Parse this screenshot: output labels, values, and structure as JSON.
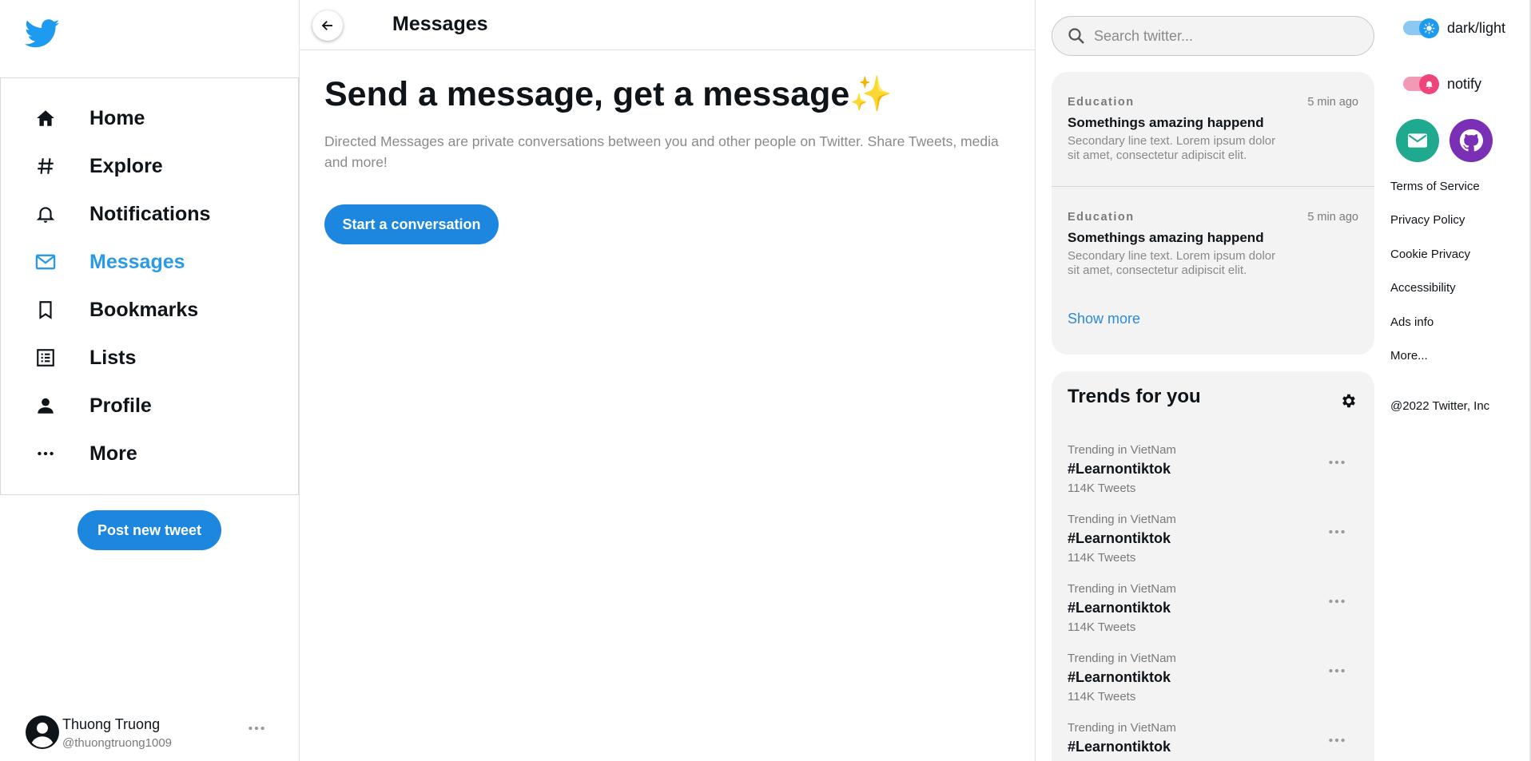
{
  "colors": {
    "accent": "#1d86df",
    "active_nav": "#2a9ae8",
    "twitter_blue": "#1d9bf0",
    "panel_bg": "#f3f3f3",
    "notify_pink": "#f0457a",
    "mail_teal": "#1faa8f",
    "github_purple": "#7b2fb4"
  },
  "sidebar": {
    "logo_icon": "twitter-bird-icon",
    "items": [
      {
        "label": "Home",
        "icon": "home-icon"
      },
      {
        "label": "Explore",
        "icon": "hashtag-icon"
      },
      {
        "label": "Notifications",
        "icon": "bell-icon"
      },
      {
        "label": "Messages",
        "icon": "mail-icon",
        "active": true
      },
      {
        "label": "Bookmarks",
        "icon": "bookmark-icon"
      },
      {
        "label": "Lists",
        "icon": "list-icon"
      },
      {
        "label": "Profile",
        "icon": "person-icon"
      },
      {
        "label": "More",
        "icon": "more-horizontal-icon"
      }
    ],
    "post_button": "Post new tweet",
    "user": {
      "name": "Thuong Truong",
      "handle": "@thuongtruong1009"
    }
  },
  "main": {
    "header_title": "Messages",
    "hero_title": "Send a message, get a message",
    "hero_emoji": "✨",
    "description": "Directed Messages are private conversations between you and other people on Twitter. Share Tweets, media and more!",
    "start_button": "Start a conversation"
  },
  "search": {
    "placeholder": "Search twitter..."
  },
  "news": {
    "items": [
      {
        "category": "Education",
        "time": "5 min ago",
        "title": "Somethings amazing happend",
        "body": "Secondary line text. Lorem ipsum dolor sit amet, consectetur adipiscit elit."
      },
      {
        "category": "Education",
        "time": "5 min ago",
        "title": "Somethings amazing happend",
        "body": "Secondary line text. Lorem ipsum dolor sit amet, consectetur adipiscit elit."
      }
    ],
    "show_more": "Show more"
  },
  "trends": {
    "title": "Trends for you",
    "items": [
      {
        "place": "Trending in VietNam",
        "tag": "#Learnontiktok",
        "count": "114K Tweets"
      },
      {
        "place": "Trending in VietNam",
        "tag": "#Learnontiktok",
        "count": "114K Tweets"
      },
      {
        "place": "Trending in VietNam",
        "tag": "#Learnontiktok",
        "count": "114K Tweets"
      },
      {
        "place": "Trending in VietNam",
        "tag": "#Learnontiktok",
        "count": "114K Tweets"
      },
      {
        "place": "Trending in VietNam",
        "tag": "#Learnontiktok",
        "count": ""
      }
    ]
  },
  "settings_panel": {
    "theme_toggle_label": "dark/light",
    "notify_toggle_label": "notify",
    "links": [
      "Terms of Service",
      "Privacy Policy",
      "Cookie Privacy",
      "Accessibility",
      "Ads info",
      "More..."
    ],
    "copyright": "@2022 Twitter, Inc"
  }
}
